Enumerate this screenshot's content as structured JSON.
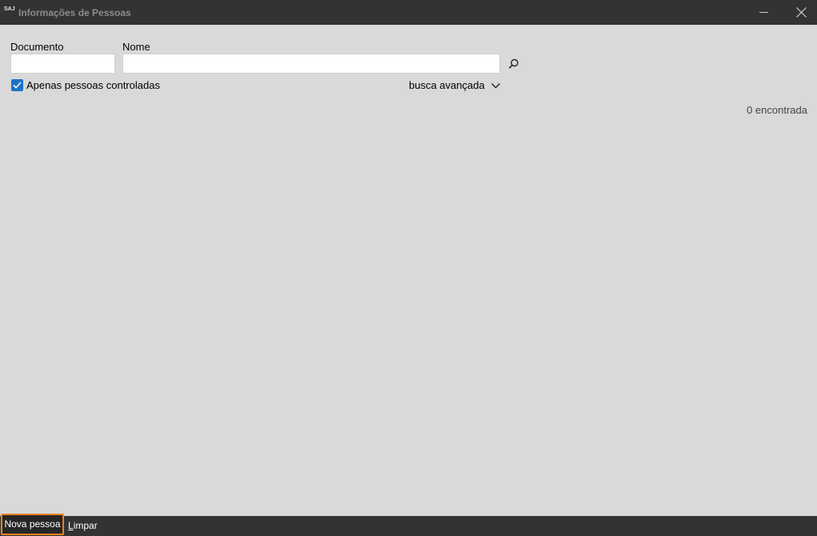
{
  "titlebar": {
    "logo": "SAJ",
    "title": "Informações de Pessoas"
  },
  "form": {
    "documento_label": "Documento",
    "documento_value": "",
    "nome_label": "Nome",
    "nome_value": "",
    "checkbox_label": "Apenas pessoas controladas",
    "checkbox_checked": true,
    "advanced_label": "busca avançada"
  },
  "results": {
    "count_text": "0 encontrada"
  },
  "footer": {
    "new_button": "Nova pessoa",
    "clear_button_first": "L",
    "clear_button_rest": "impar"
  },
  "colors": {
    "accent": "#1e73c8",
    "focus": "#e8821e",
    "bar": "#333333",
    "background": "#d9d9d9"
  },
  "icons": [
    "search-icon",
    "chevron-down-icon",
    "check-icon",
    "minimize-icon",
    "close-icon"
  ]
}
